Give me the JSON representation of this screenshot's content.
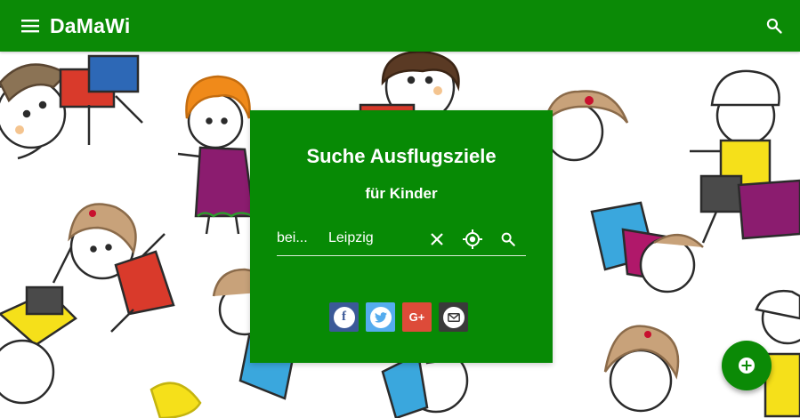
{
  "app": {
    "title": "DaMaWi"
  },
  "colors": {
    "primary": "#0b8a06",
    "facebook": "#3b5998",
    "twitter": "#55acee",
    "googleplus": "#dd4b39",
    "mail": "#3a3a3a"
  },
  "header": {
    "menu_icon": "menu-icon",
    "search_icon": "search-icon"
  },
  "search_panel": {
    "title": "Suche Ausflugsziele",
    "subtitle": "für Kinder",
    "prefix": "bei...",
    "location_value": "Leipzig"
  },
  "share": [
    {
      "name": "facebook",
      "glyph": "f"
    },
    {
      "name": "twitter",
      "glyph": "t"
    },
    {
      "name": "google-plus",
      "glyph": "G+"
    },
    {
      "name": "mail",
      "glyph": "✉"
    }
  ],
  "fab": {
    "icon": "add-circle-icon"
  }
}
